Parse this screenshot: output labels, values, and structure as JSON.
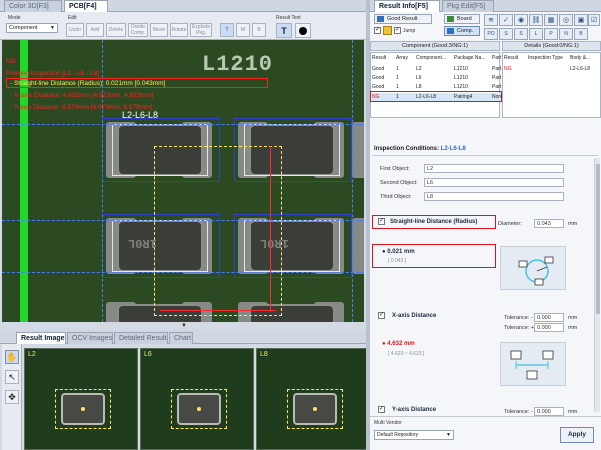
{
  "left_tabs": [
    "Color 3D[F3]",
    "PCB[F4]"
  ],
  "right_tabs": [
    "Result Info[F5]",
    "Pkg Edit[F5]"
  ],
  "toolbar": {
    "mode_label": "Mode",
    "mode_value": "Component",
    "edit_label": "Edit",
    "edit_buttons": [
      "Undo",
      "Add",
      "Delete",
      "Divide Comp.",
      "Move",
      "Rotate",
      "Explode Pkg."
    ],
    "view_buttons": [
      "T",
      "M",
      "B"
    ],
    "result_text_label": "Result Text"
  },
  "overlay": {
    "status": "NG",
    "title": "Position Inspection [L2 - L6 - L8]",
    "lines": [
      "- Straight-line Distance (Radius): 0.021mm [0.043mm]",
      "- X-axis Distance: 4.632mm [4.623mm, 4.623mm]",
      "- Y-axis Distance: 6.979mm [6.979mm, 6.979mm]"
    ],
    "component_label": "L2-L6-L8",
    "pcb_print": "L1210",
    "ink_marks": [
      "1R0L",
      "1R0L",
      "1R0L",
      "1R0L",
      "1R0L",
      "1R0L"
    ]
  },
  "bottom_tabs": [
    "Result Image",
    "OCV Images",
    "Detailed Result",
    "Chart"
  ],
  "thumbs": [
    "L2",
    "L6",
    "L8"
  ],
  "result_info": {
    "good_result": "Good Result",
    "board": "Board",
    "comp": "Comp.",
    "jump": "Jump",
    "filters": [
      "PO",
      "S",
      "S",
      "L",
      "P",
      "N",
      "B"
    ],
    "component_header": "Component (Good:3/NG:1)",
    "details_header": "Details (Good:0/NG:1)",
    "table_headers": [
      "Result",
      "Array",
      "Component...",
      "Package Na...",
      "Part"
    ],
    "rows": [
      [
        "Good",
        "1",
        "L2",
        "L1210",
        "Part"
      ],
      [
        "Good",
        "1",
        "L6",
        "L1210",
        "Part"
      ],
      [
        "Good",
        "1",
        "L8",
        "L1210",
        "Part"
      ],
      [
        "NG",
        "1",
        "L2-L6-L8",
        "Pairing4",
        "None"
      ]
    ],
    "detail_headers": [
      "Result",
      "Inspection Type",
      "Body &..."
    ],
    "detail_rows": [
      [
        "NG",
        "",
        "L2-L6-L8"
      ]
    ]
  },
  "conditions": {
    "title_prefix": "Inspection Conditions: ",
    "title_value": "L2-L6-L8",
    "first_label": "First Object:",
    "first_value": "L2",
    "second_label": "Second Object:",
    "second_value": "L6",
    "third_label": "Third Object:",
    "third_value": "L8",
    "straight_label": "Straight-line Distance (Radius)",
    "diameter_label": "Diameter:",
    "diameter_value": "0.043",
    "unit": "mm",
    "straight_result": "0.021 mm",
    "straight_ref": "[ 0.043 ]",
    "x_label": "X-axis Distance",
    "tol_minus_label": "Tolerance: -",
    "tol_plus_label": "Tolerance: +",
    "x_tol_minus": "0.000",
    "x_tol_plus": "0.000",
    "x_result": "4.632 mm",
    "x_ref": "[ 4.623 ~ 4.623 ]",
    "y_label": "Y-axis Distance",
    "y_tol_minus": "0.000"
  },
  "footer": {
    "vendor_label": "Multi Vendor",
    "vendor_value": "Default Repository",
    "apply": "Apply"
  },
  "colors": {
    "ng_red": "#d9141b",
    "accent_blue": "#2f6fc0",
    "pcb_green": "#2c4a22",
    "highlight_yellow": "#ffe75c"
  }
}
